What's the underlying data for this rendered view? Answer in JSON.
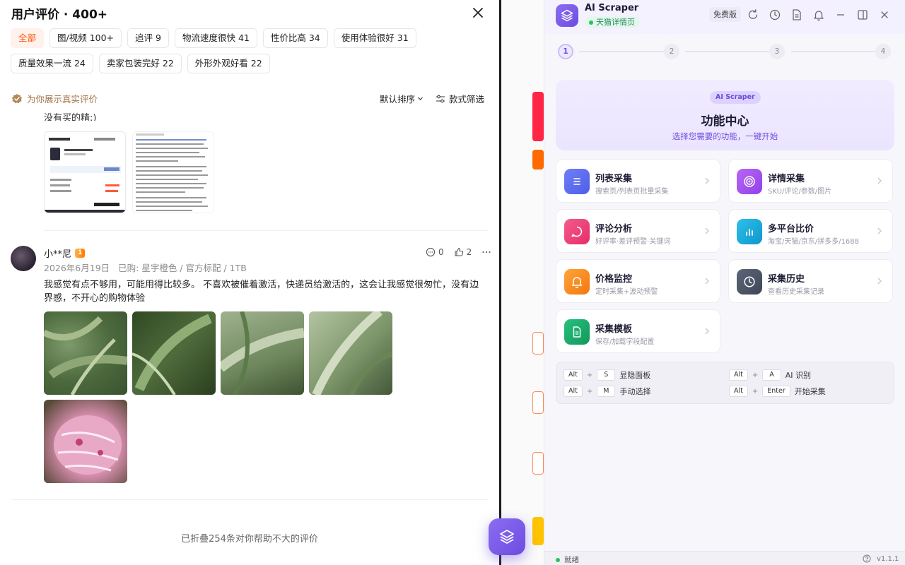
{
  "reviews_panel": {
    "title": "用户评价 · 400+",
    "filter_tags": [
      {
        "label": "全部",
        "active": true
      },
      {
        "label": "图/视频 100+",
        "active": false
      },
      {
        "label": "追评 9",
        "active": false
      },
      {
        "label": "物流速度很快 41",
        "active": false
      },
      {
        "label": "性价比高 34",
        "active": false
      },
      {
        "label": "使用体验很好 31",
        "active": false
      },
      {
        "label": "质量效果一流 24",
        "active": false
      },
      {
        "label": "卖家包装完好 22",
        "active": false
      },
      {
        "label": "外形外观好看 22",
        "active": false
      }
    ],
    "real_reviews_note": "为你展示真实评价",
    "sort_label": "默认排序",
    "filter_label": "款式筛选",
    "partial_review_text": "没有买的精:)",
    "review": {
      "username": "小**尼",
      "vip_level": "1",
      "date": "2026年6月19日",
      "purchase": "已购: 星宇橙色 / 官方标配 / 1TB",
      "comment_count": "0",
      "like_count": "2",
      "text": "我感觉有点不够用，可能用得比较多。 不喜欢被催着激活，快递员给激活的，这会让我感觉很匆忙，没有边界感，不开心的购物体验"
    },
    "folded_note": "已折叠254条对你帮助不大的评价"
  },
  "scraper": {
    "app_name": "AI Scraper",
    "page_type": "天猫详情页",
    "plan": "免费版",
    "steps": [
      "1",
      "2",
      "3",
      "4"
    ],
    "hero": {
      "badge": "AI Scraper",
      "title": "功能中心",
      "subtitle": "选择您需要的功能，一键开始"
    },
    "features": [
      {
        "title": "列表采集",
        "desc": "搜索页/列表页批量采集",
        "icon": "list-icon",
        "color": "#5b6ef5"
      },
      {
        "title": "详情采集",
        "desc": "SKU/评论/参数/图片",
        "icon": "target-icon",
        "color": "#a14ff0"
      },
      {
        "title": "评论分析",
        "desc": "好评率·差评预警·关键词",
        "icon": "chat-icon",
        "color": "#ef3f7a"
      },
      {
        "title": "多平台比价",
        "desc": "淘宝/天猫/京东/拼多多/1688",
        "icon": "bar-chart-icon",
        "color": "#16a8d8"
      },
      {
        "title": "价格监控",
        "desc": "定时采集+波动预警",
        "icon": "bell-icon",
        "color": "#f6891f"
      },
      {
        "title": "采集历史",
        "desc": "查看历史采集记录",
        "icon": "clock-icon",
        "color": "#4d5668"
      },
      {
        "title": "采集模板",
        "desc": "保存/加载字段配置",
        "icon": "document-icon",
        "color": "#19a86a"
      }
    ],
    "shortcuts": [
      {
        "keys": [
          "Alt",
          "S"
        ],
        "label": "显隐面板"
      },
      {
        "keys": [
          "Alt",
          "A"
        ],
        "label": "AI 识别"
      },
      {
        "keys": [
          "Alt",
          "M"
        ],
        "label": "手动选择"
      },
      {
        "keys": [
          "Alt",
          "Enter"
        ],
        "label": "开始采集"
      }
    ],
    "status": "就绪",
    "version": "v1.1.1"
  },
  "colors": {
    "accent_orange": "#ff5000",
    "accent_purple": "#6d4cdf",
    "ready_green": "#22c55e"
  }
}
